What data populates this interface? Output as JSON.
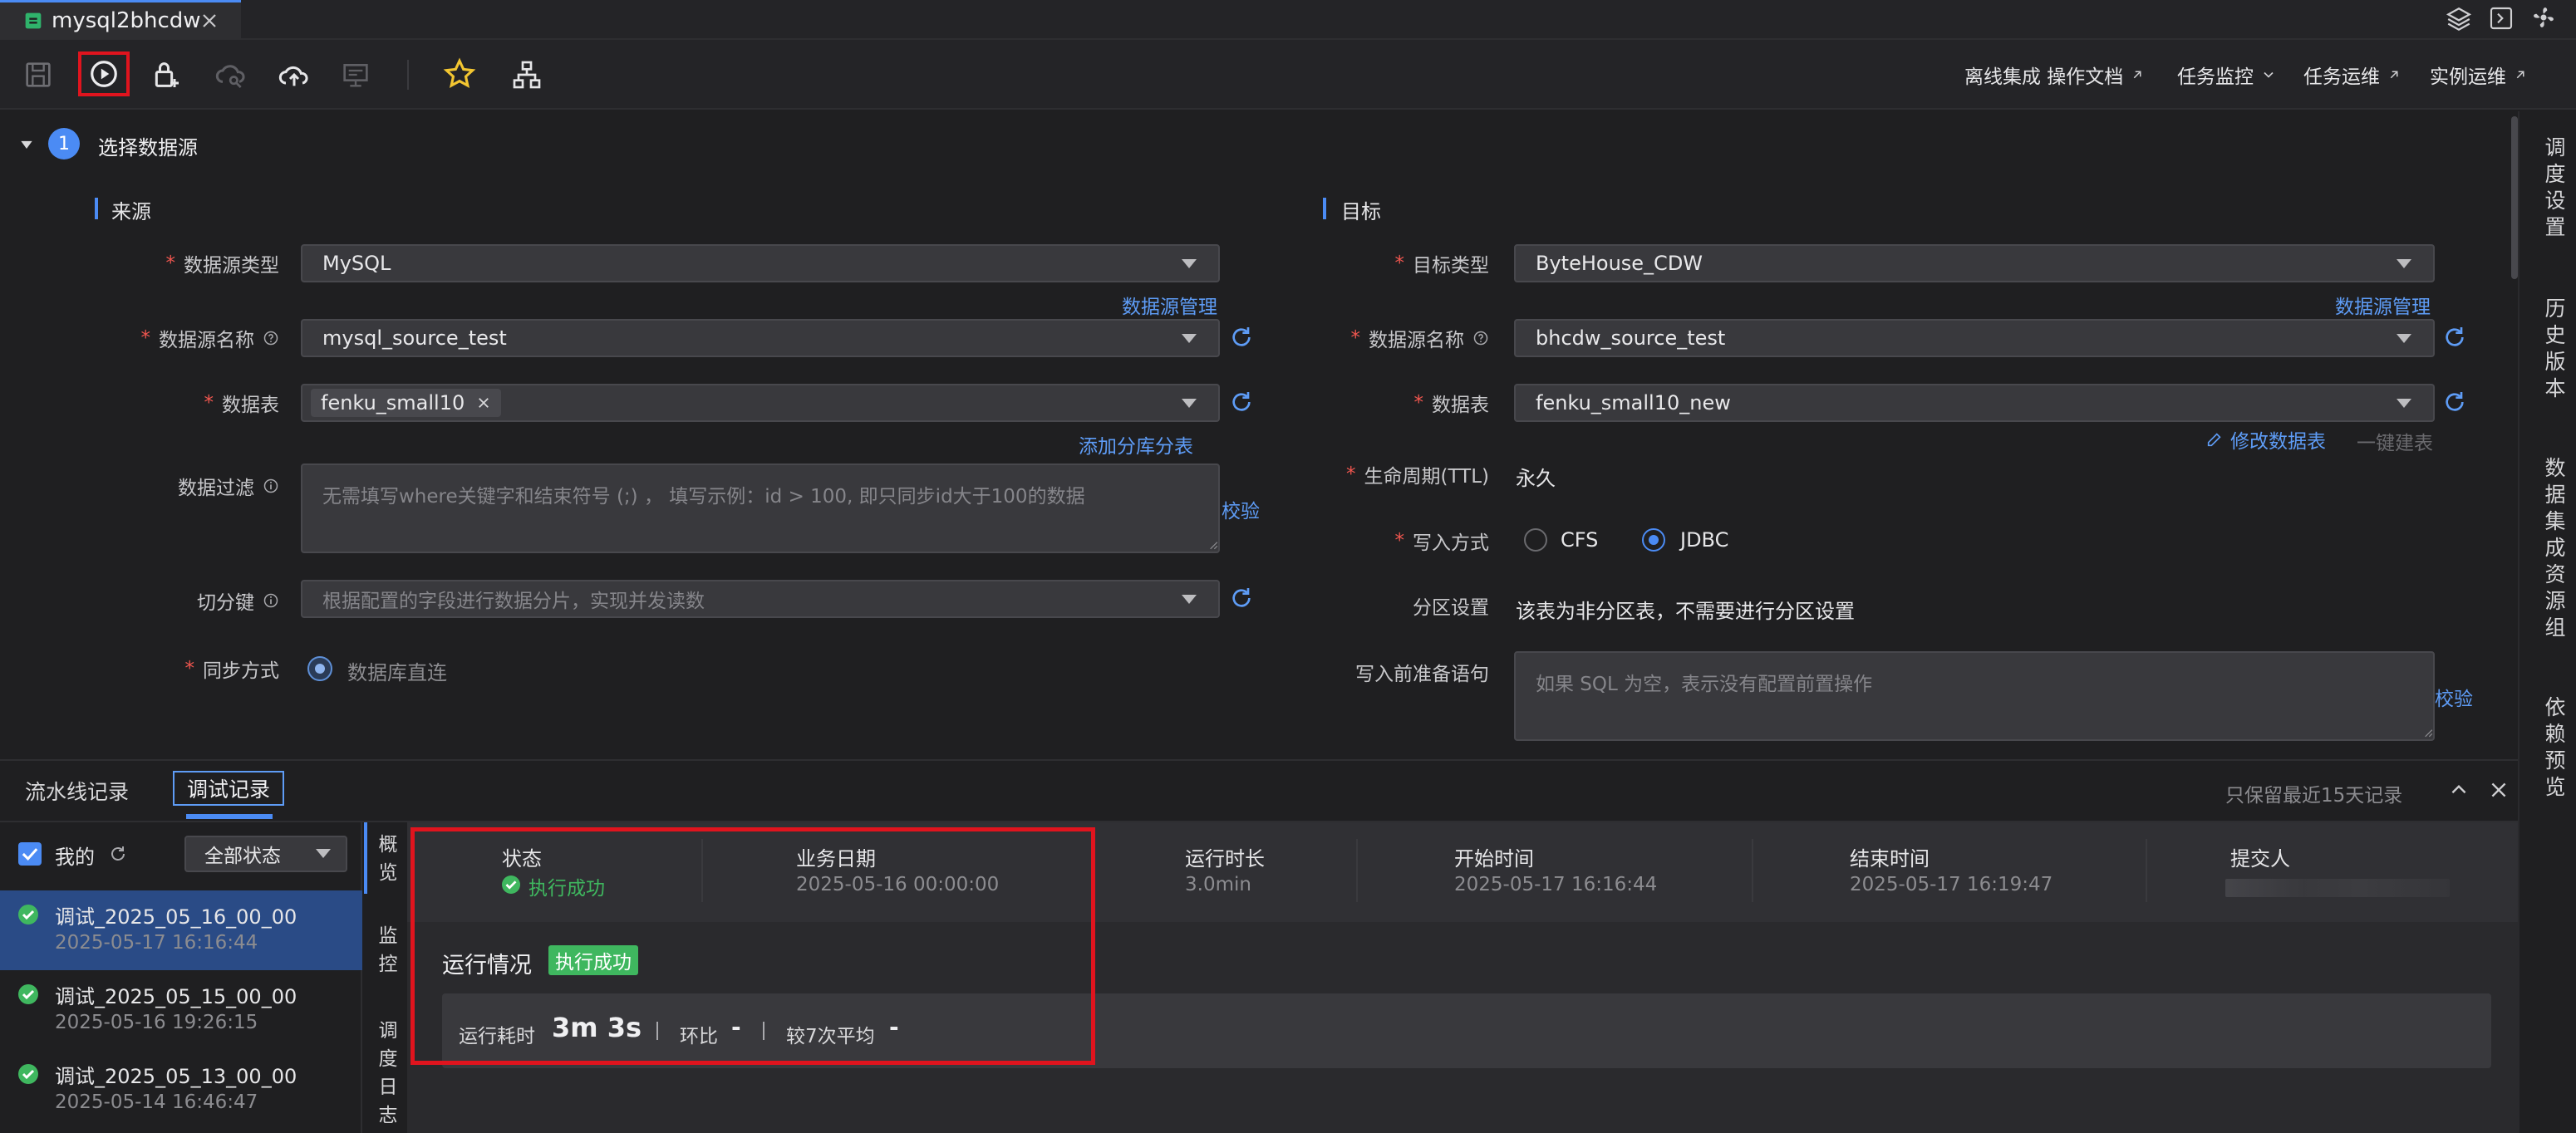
{
  "tab": {
    "title": "mysql2bhcdw"
  },
  "toolbar": {
    "links": [
      "离线集成 操作文档",
      "任务监控",
      "任务运维",
      "实例运维"
    ]
  },
  "section": {
    "number": "1",
    "title": "选择数据源"
  },
  "source": {
    "heading": "来源",
    "type_label": "数据源类型",
    "type_value": "MySQL",
    "manage_link": "数据源管理",
    "name_label": "数据源名称",
    "name_value": "mysql_source_test",
    "table_label": "数据表",
    "table_tag": "fenku_small10",
    "add_shard_link": "添加分库分表",
    "filter_label": "数据过滤",
    "filter_placeholder": "无需填写where关键字和结束符号 (;) ， 填写示例：id > 100, 即只同步id大于100的数据",
    "validate_link": "校验",
    "split_label": "切分键",
    "split_placeholder": "根据配置的字段进行数据分片，实现并发读数",
    "sync_label": "同步方式",
    "sync_value": "数据库直连"
  },
  "target": {
    "heading": "目标",
    "type_label": "目标类型",
    "type_value": "ByteHouse_CDW",
    "manage_link": "数据源管理",
    "name_label": "数据源名称",
    "name_value": "bhcdw_source_test",
    "table_label": "数据表",
    "table_value": "fenku_small10_new",
    "modify_link": "修改数据表",
    "create_link": "一键建表",
    "ttl_label": "生命周期(TTL)",
    "ttl_value": "永久",
    "write_label": "写入方式",
    "write_opt1": "CFS",
    "write_opt2": "JDBC",
    "partition_label": "分区设置",
    "partition_value": "该表为非分区表，不需要进行分区设置",
    "pre_sql_label": "写入前准备语句",
    "pre_sql_placeholder": "如果 SQL 为空，表示没有配置前置操作",
    "validate_link": "校验"
  },
  "right_sidebar": [
    "调度设置",
    "历史版本",
    "数据集成资源组",
    "依赖预览"
  ],
  "bottom": {
    "tab1": "流水线记录",
    "tab2": "调试记录",
    "retention_note": "只保留最近15天记录",
    "mine_label": "我的",
    "status_filter": "全部状态",
    "records": [
      {
        "name": "调试_2025_05_16_00_00",
        "time": "2025-05-17 16:16:44"
      },
      {
        "name": "调试_2025_05_15_00_00",
        "time": "2025-05-16 19:26:15"
      },
      {
        "name": "调试_2025_05_13_00_00",
        "time": "2025-05-14 16:46:47"
      }
    ],
    "side_tabs": [
      "概览",
      "监控",
      "调度日志"
    ],
    "summary": {
      "status_h": "状态",
      "status_v": "执行成功",
      "date_h": "业务日期",
      "date_v": "2025-05-16 00:00:00",
      "duration_h": "运行时长",
      "duration_v": "3.0min",
      "start_h": "开始时间",
      "start_v": "2025-05-17 16:16:44",
      "end_h": "结束时间",
      "end_v": "2025-05-17 16:19:47",
      "submitter_h": "提交人"
    },
    "run": {
      "title": "运行情况",
      "badge": "执行成功",
      "elapsed_label": "运行耗时",
      "elapsed_value": "3m 3s",
      "ratio_label": "环比",
      "ratio_value": "-",
      "avg_label": "较7次平均",
      "avg_value": "-"
    }
  },
  "colors": {
    "accent": "#4b8bf4",
    "success": "#3fb75f",
    "highlight": "#e0141e",
    "required": "#f0564f"
  }
}
